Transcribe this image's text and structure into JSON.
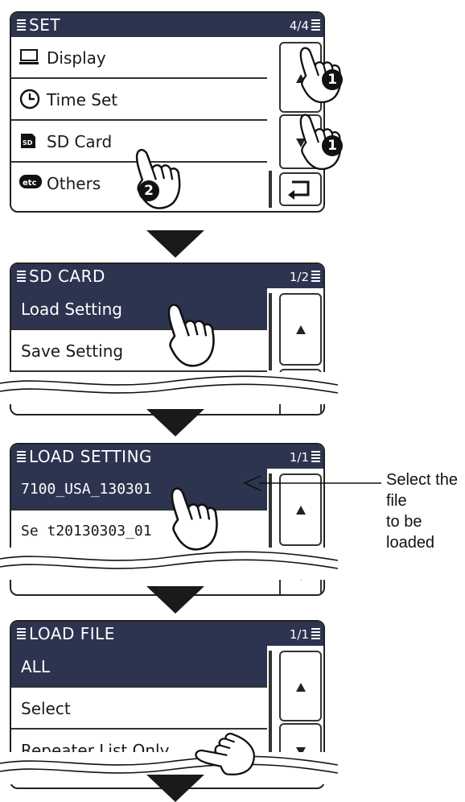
{
  "screen1": {
    "title": "SET",
    "page": "4/4",
    "items": [
      {
        "label": "Display",
        "icon": "display-icon"
      },
      {
        "label": "Time Set",
        "icon": "clock-icon"
      },
      {
        "label": "SD Card",
        "icon": "sd-card-icon"
      },
      {
        "label": "Others",
        "icon": "etc-icon"
      }
    ],
    "steps": {
      "up": "1",
      "down": "1",
      "select": "2"
    }
  },
  "screen2": {
    "title": "SD CARD",
    "page": "1/2",
    "items": [
      {
        "label": "Load Setting",
        "selected": true
      },
      {
        "label": "Save Setting",
        "selected": false
      }
    ]
  },
  "screen3": {
    "title": "LOAD SETTING",
    "page": "1/1",
    "items": [
      {
        "label": "7100_USA_130301",
        "selected": true
      },
      {
        "label": "Se t20130303_01",
        "selected": false
      }
    ]
  },
  "screen4": {
    "title": "LOAD FILE",
    "page": "1/1",
    "items": [
      {
        "label": "ALL",
        "selected": true
      },
      {
        "label": "Select",
        "selected": false
      },
      {
        "label": "Repeater List Only",
        "selected": false
      }
    ]
  },
  "callout": {
    "line1": "Select the file",
    "line2": "to be loaded"
  },
  "colors": {
    "titlebar": "#2d3450",
    "selected_row": "#2d3450",
    "outline": "#222222"
  }
}
